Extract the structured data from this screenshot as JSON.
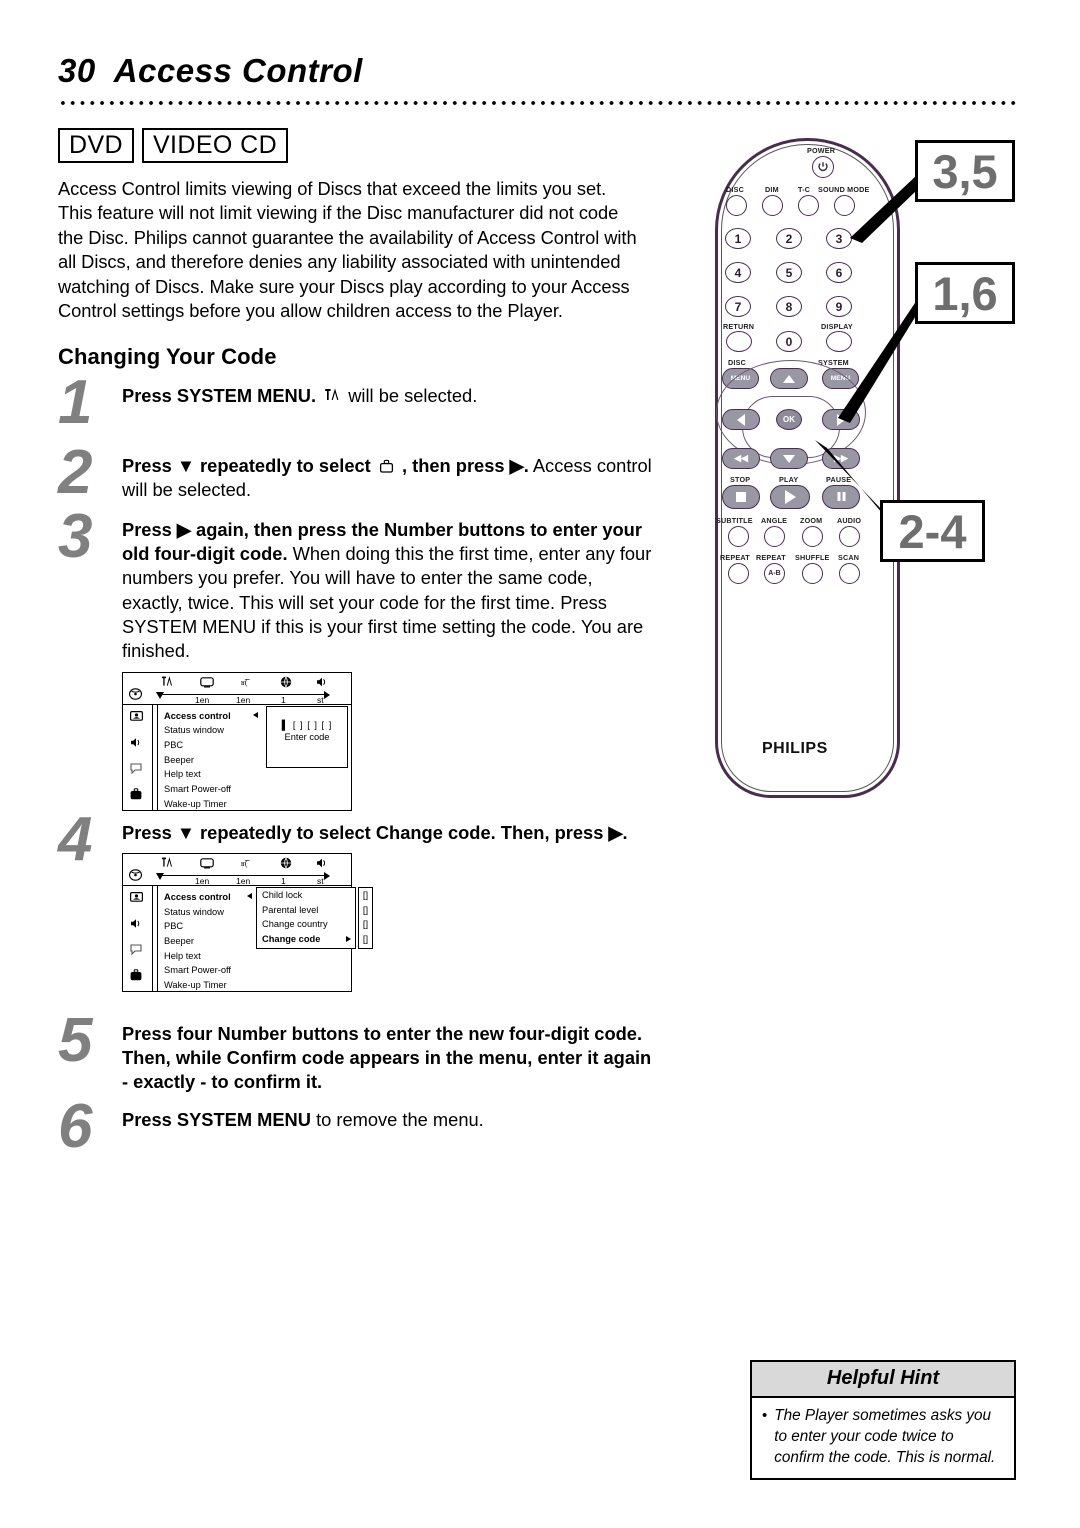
{
  "page": {
    "number": "30",
    "title": "Access Control"
  },
  "badges": [
    {
      "label": "DVD"
    },
    {
      "label": "VIDEO CD"
    }
  ],
  "intro": "Access Control limits viewing of Discs that exceed the limits you set. This feature will not limit viewing if the Disc manufacturer did not code the Disc.  Philips cannot guarantee the availability of Access Control with all Discs, and therefore denies any liability associated with unintended watching of Discs.  Make sure your Discs play according to your Access Control settings before you allow children access to the Player.",
  "section_heading": "Changing Your Code",
  "steps": [
    {
      "number": "1",
      "bold_lead": "Press SYSTEM MENU.",
      "icon": "system-menu-icon",
      "rest": "will be selected."
    },
    {
      "number": "2",
      "bold_lead": "Press ▼ repeatedly to select",
      "icon": "lock-briefcase-icon",
      "bold_mid": ", then press ▶.",
      "rest": "Access control will be selected."
    },
    {
      "number": "3",
      "bold_lead": "Press ▶ again, then press the Number buttons to enter your old four-digit code.",
      "rest": "When doing this the first time, enter any four numbers you prefer. You will have to enter the same code, exactly, twice. This will set your code for the first time. Press SYSTEM MENU if this is your first time setting the code. You are finished."
    },
    {
      "number": "4",
      "bold_lead": "Press ▼ repeatedly to select Change code. Then, press ▶."
    },
    {
      "number": "5",
      "bold_lead": "Press four Number buttons to enter the new four-digit code. Then, while Confirm code appears in the menu, enter it again - exactly - to confirm it."
    },
    {
      "number": "6",
      "bold_lead": "Press SYSTEM MENU",
      "rest": "to remove the menu."
    }
  ],
  "osd": {
    "tabs": [
      {
        "icon": "disc-icon",
        "label": ""
      },
      {
        "icon": "system-menu-icon",
        "label": ""
      },
      {
        "icon": "tv-screen-icon",
        "label": "1en"
      },
      {
        "icon": "subtitle-icon",
        "label": "1en"
      },
      {
        "icon": "language-globe-icon",
        "label": "1"
      },
      {
        "icon": "audio-speaker-icon",
        "label": "st"
      }
    ],
    "rail_icons": [
      "picture-icon",
      "sound-icon",
      "subtitle-bubble-icon",
      "lock-briefcase-icon"
    ],
    "menu_items": [
      "Access control",
      "Status window",
      "PBC",
      "Beeper",
      "Help text",
      "Smart Power-off",
      "Wake-up Timer"
    ],
    "selected_item": "Access control",
    "panel_a": {
      "code_boxes": "▌ [ ] [ ] [ ]",
      "code_label": "Enter code"
    },
    "panel_b": {
      "rows": [
        {
          "label": "Child lock",
          "value": "[]"
        },
        {
          "label": "Parental level",
          "value": "[]"
        },
        {
          "label": "Change country",
          "value": "[]"
        },
        {
          "label": "Change code",
          "value": "[]"
        }
      ],
      "selected_row": "Change code"
    }
  },
  "remote": {
    "brand": "PHILIPS",
    "power_label": "POWER",
    "top_row": [
      {
        "label": "DISC"
      },
      {
        "label": "DIM"
      },
      {
        "label": "T-C"
      },
      {
        "label": "SOUND MODE"
      }
    ],
    "number_keys": [
      "1",
      "2",
      "3",
      "4",
      "5",
      "6",
      "7",
      "8",
      "9",
      "0"
    ],
    "return_label": "RETURN",
    "display_label": "DISPLAY",
    "disc_menu_label": "DISC",
    "system_menu_label": "SYSTEM",
    "menu_btn_label": "MENU",
    "ok_label": "OK",
    "transport_labels": [
      {
        "label": "STOP"
      },
      {
        "label": "PLAY"
      },
      {
        "label": "PAUSE"
      }
    ],
    "feature_row_1": [
      "SUBTITLE",
      "ANGLE",
      "ZOOM",
      "AUDIO"
    ],
    "feature_row_2": [
      "REPEAT",
      "REPEAT",
      "SHUFFLE",
      "SCAN"
    ],
    "repeat_ab_label": "A-B"
  },
  "callouts": [
    {
      "id": "callout-35",
      "text": "3,5"
    },
    {
      "id": "callout-16",
      "text": "1,6"
    },
    {
      "id": "callout-24",
      "text": "2-4"
    }
  ],
  "helpful_hint": {
    "title": "Helpful Hint",
    "bullet": "•",
    "text": "The Player sometimes asks you to enter your code twice to confirm the code. This is normal."
  },
  "colors": {
    "callout_text": "#6e6e6e",
    "step_number": "#808080",
    "remote_outline": "#4a2d4e",
    "hint_header_bg": "#d9d9d9"
  }
}
